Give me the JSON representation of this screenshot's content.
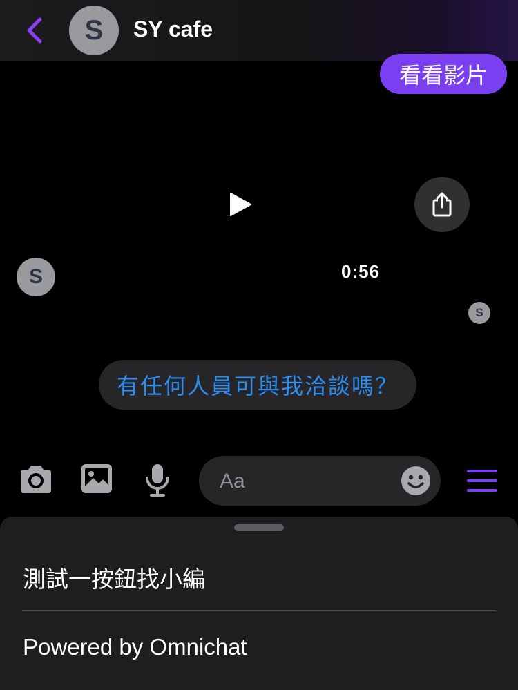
{
  "header": {
    "back_icon": "chevron-left-icon",
    "avatar_initial": "S",
    "title": "SY cafe",
    "accent": "#7b3ff2"
  },
  "messages": {
    "sent_text": "看看影片",
    "video": {
      "duration": "0:56",
      "play_icon": "play-icon",
      "share_icon": "share-icon"
    },
    "sender_avatar_initial": "S",
    "read_receipt_initial": "S",
    "quick_reply": "有任何人員可與我洽談嗎？"
  },
  "composer": {
    "placeholder": "Aa",
    "icons": [
      "camera-icon",
      "image-icon",
      "microphone-icon",
      "emoji-icon",
      "menu-icon"
    ]
  },
  "sheet": {
    "items": [
      {
        "label": "測試一按鈕找小編"
      },
      {
        "label": "Powered by Omnichat"
      }
    ]
  }
}
